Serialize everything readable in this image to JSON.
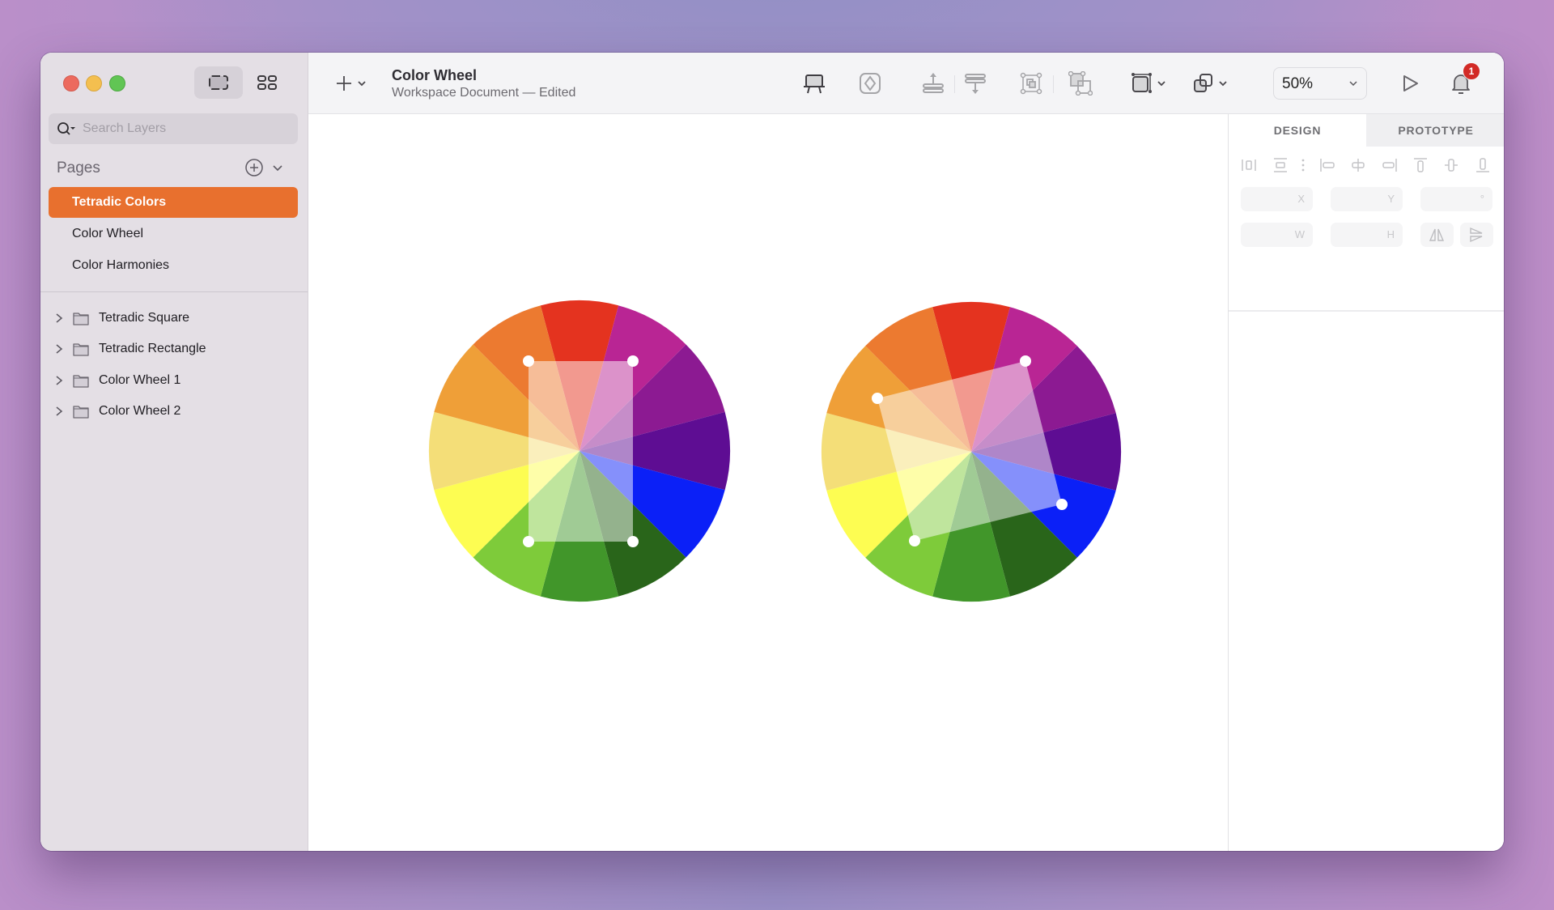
{
  "window": {
    "traffic_lights": [
      "close",
      "minimize",
      "zoom"
    ]
  },
  "sidebar": {
    "view_toggle": {
      "active": "canvas-view-icon",
      "inactive": "components-grid-icon"
    },
    "search": {
      "placeholder": "Search Layers",
      "value": "",
      "icon": "search-icon"
    },
    "pages_title": "Pages",
    "pages": [
      {
        "label": "Tetradic Colors",
        "selected": true
      },
      {
        "label": "Color Wheel",
        "selected": false
      },
      {
        "label": "Color Harmonies",
        "selected": false
      }
    ],
    "layers": [
      {
        "label": "Tetradic Square",
        "icon": "folder-icon",
        "expanded": false
      },
      {
        "label": "Tetradic Rectangle",
        "icon": "folder-icon",
        "expanded": false
      },
      {
        "label": "Color Wheel 1",
        "icon": "folder-icon",
        "expanded": false
      },
      {
        "label": "Color Wheel 2",
        "icon": "folder-icon",
        "expanded": false
      }
    ]
  },
  "toolbar": {
    "insert_icon": "plus-icon",
    "document_title": "Color Wheel",
    "document_subtitle": "Workspace Document — Edited",
    "tools": [
      "artboard-icon",
      "symbol-icon",
      "move-forward-icon",
      "move-backward-icon",
      "mask-icon",
      "group-icon",
      "resize-icon",
      "boolean-icon"
    ],
    "zoom_value": "50%",
    "play_icon": "play-icon",
    "notifications_count": "1"
  },
  "canvas": {
    "wheels": [
      {
        "name": "Color Wheel 1",
        "overlay": "Tetradic Rectangle"
      },
      {
        "name": "Color Wheel 2",
        "overlay": "Tetradic Square"
      }
    ],
    "segment_colors_clockwise_from_top": [
      "#e4331f",
      "#b92594",
      "#8c1a92",
      "#5e0d93",
      "#0b20f7",
      "#29651a",
      "#41962a",
      "#7ecb3a",
      "#fdfd52",
      "#f4de78",
      "#ef9f38",
      "#ec7a30"
    ],
    "overlay_color": "#ffffff"
  },
  "inspector": {
    "tabs": [
      {
        "label": "DESIGN",
        "active": true
      },
      {
        "label": "PROTOTYPE",
        "active": false
      }
    ],
    "align_icons": [
      "distribute-horizontal-icon",
      "distribute-vertical-icon",
      "more-icon",
      "align-left-icon",
      "align-center-horizontal-icon",
      "align-right-icon",
      "align-top-icon",
      "align-middle-icon",
      "align-bottom-icon"
    ],
    "fields": {
      "x": "X",
      "y": "Y",
      "rotation": "°",
      "w": "W",
      "h": "H"
    },
    "flip_icons": [
      "flip-horizontal-icon",
      "flip-vertical-icon"
    ]
  }
}
